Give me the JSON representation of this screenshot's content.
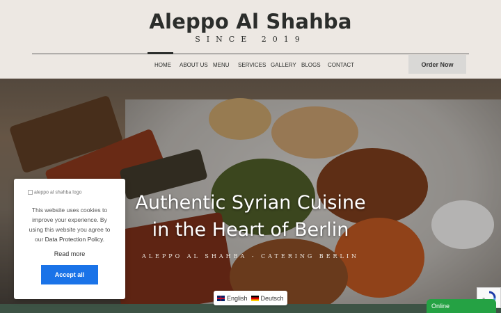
{
  "header": {
    "title": "Aleppo Al Shahba",
    "subtitle": "SINCE 2019",
    "nav": [
      "HOME",
      "ABOUT US",
      "MENU",
      "SERVICES",
      "GALLERY",
      "BLOGS",
      "CONTACT"
    ],
    "active_nav": "HOME",
    "order_button": "Order Now"
  },
  "hero": {
    "title_line1": "Authentic Syrian Cuisine",
    "title_line2": "in the Heart of Berlin",
    "subtitle": "ALEPPO AL SHAHBA - CATERING BERLIN"
  },
  "cookie_notice": {
    "logo_alt": "aleppo al shahba logo",
    "text_before_link": "This website uses cookies to improve your experience. By using this website you agree to our ",
    "link_text": "Data Protection Policy",
    "text_after_link": ".",
    "read_more": "Read more",
    "accept_button": "Accept all"
  },
  "language_switcher": {
    "options": [
      {
        "label": "English",
        "icon": "uk-flag-icon"
      },
      {
        "label": "Deutsch",
        "icon": "german-flag-icon"
      }
    ]
  },
  "chat_widget": {
    "label": "Online"
  },
  "colors": {
    "brand_dark": "#2b2d2b",
    "accept_blue": "#1a73e8",
    "chat_green": "#25a244",
    "footer_green": "#3d5345"
  }
}
